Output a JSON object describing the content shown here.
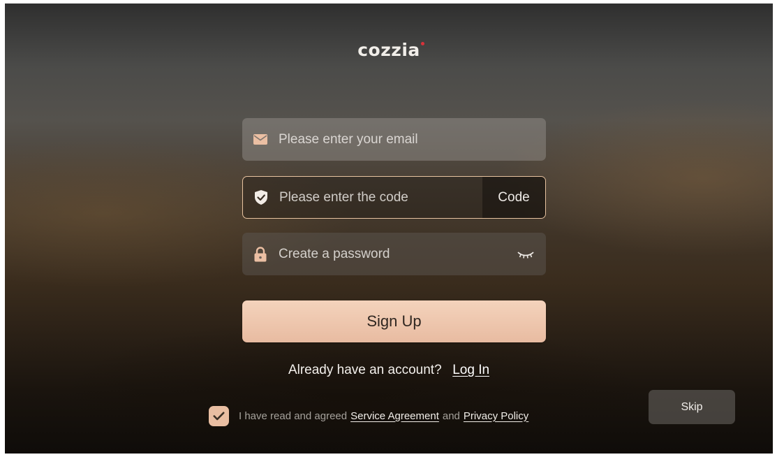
{
  "app": {
    "logo_text": "cozzia"
  },
  "form": {
    "email": {
      "placeholder": "Please enter your email",
      "icon": "envelope-icon"
    },
    "code": {
      "placeholder": "Please enter the code",
      "icon": "shield-check-icon",
      "button_label": "Code"
    },
    "password": {
      "placeholder": "Create a password",
      "icon": "lock-icon",
      "visibility_icon": "eye-closed-icon"
    },
    "signup_label": "Sign Up"
  },
  "login_prompt": {
    "text": "Already have an account?",
    "link_label": "Log In"
  },
  "agreement": {
    "checked": true,
    "prefix": "I have read and agreed",
    "service_link": "Service Agreement",
    "conjunction": "and",
    "privacy_link": "Privacy Policy"
  },
  "skip_label": "Skip",
  "colors": {
    "accent": "#e9bea2",
    "code_border": "#e8c3a0",
    "logo_dot": "#d8323a"
  }
}
